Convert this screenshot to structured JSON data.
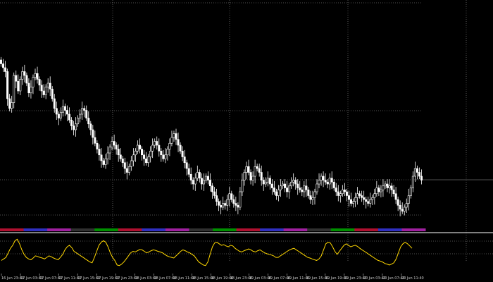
{
  "chart_data": {
    "type": "candlestick",
    "colors": {
      "background": "#000000",
      "candle_bull": "#ffffff",
      "candle_bear": "#ffffff",
      "candle_doji": "#00aa00",
      "indicator_line": "#ffd700",
      "grid": "#6a6a6a",
      "separator": "#ffffff",
      "session_bar": [
        "#b01030",
        "#3030c0",
        "#a020a0",
        "#303030",
        "#009000"
      ]
    },
    "grid": true,
    "price_ylim": [
      0,
      100
    ],
    "price_series": {
      "name": "",
      "close": [
        78,
        76,
        74,
        60,
        55,
        58,
        72,
        69,
        64,
        70,
        74,
        72,
        68,
        63,
        66,
        71,
        73,
        70,
        67,
        64,
        62,
        66,
        68,
        65,
        60,
        55,
        52,
        50,
        53,
        56,
        54,
        52,
        49,
        46,
        44,
        47,
        50,
        52,
        55,
        54,
        50,
        47,
        44,
        40,
        37,
        34,
        31,
        28,
        26,
        29,
        32,
        35,
        38,
        36,
        34,
        31,
        29,
        27,
        24,
        22,
        25,
        28,
        31,
        33,
        36,
        34,
        31,
        29,
        27,
        30,
        33,
        36,
        38,
        36,
        33,
        31,
        29,
        31,
        34,
        37,
        40,
        42,
        39,
        36,
        33,
        30,
        27,
        24,
        21,
        18,
        16,
        19,
        22,
        19,
        16,
        18,
        20,
        18,
        15,
        12,
        10,
        7,
        5,
        4,
        6,
        5,
        8,
        11,
        8,
        6,
        5,
        4,
        12,
        18,
        22,
        25,
        22,
        18,
        20,
        25,
        24,
        22,
        18,
        16,
        17,
        19,
        16,
        14,
        12,
        10,
        13,
        15,
        16,
        14,
        12,
        15,
        17,
        18,
        16,
        14,
        13,
        12,
        15,
        13,
        10,
        8,
        9,
        12,
        16,
        18,
        20,
        18,
        17,
        16,
        19,
        17,
        14,
        12,
        10,
        11,
        13,
        12,
        10,
        8,
        6,
        7,
        9,
        11,
        10,
        9,
        8,
        7,
        6,
        8,
        9,
        11,
        14,
        12,
        13,
        15,
        16,
        14,
        15,
        13,
        11,
        8,
        5,
        3,
        2,
        4,
        6,
        10,
        14,
        20,
        24,
        22,
        20,
        18
      ]
    },
    "indicator_ylim": [
      0,
      100
    ],
    "indicator_series": {
      "name": "",
      "values": [
        20,
        25,
        30,
        45,
        60,
        70,
        85,
        90,
        75,
        55,
        40,
        30,
        25,
        22,
        28,
        35,
        33,
        30,
        28,
        25,
        30,
        35,
        32,
        28,
        25,
        22,
        30,
        40,
        55,
        65,
        70,
        62,
        50,
        45,
        40,
        35,
        30,
        25,
        20,
        15,
        12,
        30,
        50,
        70,
        80,
        85,
        80,
        65,
        45,
        30,
        20,
        5,
        3,
        8,
        15,
        25,
        35,
        45,
        50,
        48,
        52,
        56,
        55,
        50,
        45,
        48,
        52,
        55,
        53,
        50,
        48,
        45,
        40,
        35,
        32,
        30,
        28,
        35,
        42,
        50,
        55,
        52,
        48,
        45,
        40,
        35,
        25,
        15,
        10,
        5,
        3,
        15,
        40,
        65,
        78,
        80,
        75,
        70,
        72,
        68,
        65,
        70,
        68,
        60,
        55,
        50,
        48,
        52,
        55,
        58,
        55,
        50,
        48,
        52,
        55,
        50,
        45,
        42,
        40,
        38,
        35,
        30,
        30,
        35,
        40,
        45,
        50,
        55,
        58,
        60,
        55,
        50,
        45,
        40,
        35,
        30,
        28,
        25,
        22,
        20,
        25,
        35,
        55,
        75,
        80,
        78,
        65,
        50,
        40,
        50,
        60,
        70,
        75,
        70,
        65,
        68,
        70,
        66,
        60,
        55,
        50,
        45,
        40,
        35,
        30,
        25,
        20,
        18,
        15,
        10,
        8,
        5,
        8,
        12,
        25,
        45,
        65,
        75,
        80,
        75,
        68,
        60
      ]
    },
    "session_bands": [
      "#b01030",
      "#3030c0",
      "#a020a0",
      "#303030",
      "#009000",
      "#b01030",
      "#3030c0",
      "#a020a0",
      "#303030",
      "#009000",
      "#b01030",
      "#3030c0",
      "#a020a0",
      "#303030",
      "#009000",
      "#b01030",
      "#3030c0",
      "#a020a0"
    ],
    "x_tick_labels": [
      "16 Jun 23:40",
      "17 Jun 03:40",
      "17 Jun 07:40",
      "17 Jun 11:40",
      "17 Jun 15:40",
      "17 Jun 19:40",
      "17 Jun 23:40",
      "18 Jun 03:40",
      "18 Jun 07:40",
      "18 Jun 11:40",
      "18 Jun 15:40",
      "18 Jun 19:40",
      "18 Jun 23:40",
      "19 Jun 03:40",
      "19 Jun 07:40",
      "19 Jun 11:40",
      "19 Jun 15:40",
      "19 Jun 19:40",
      "19 Jun 23:40",
      "20 Jun 03:40",
      "20 Jun 07:40",
      "20 Jun 11:40"
    ]
  }
}
